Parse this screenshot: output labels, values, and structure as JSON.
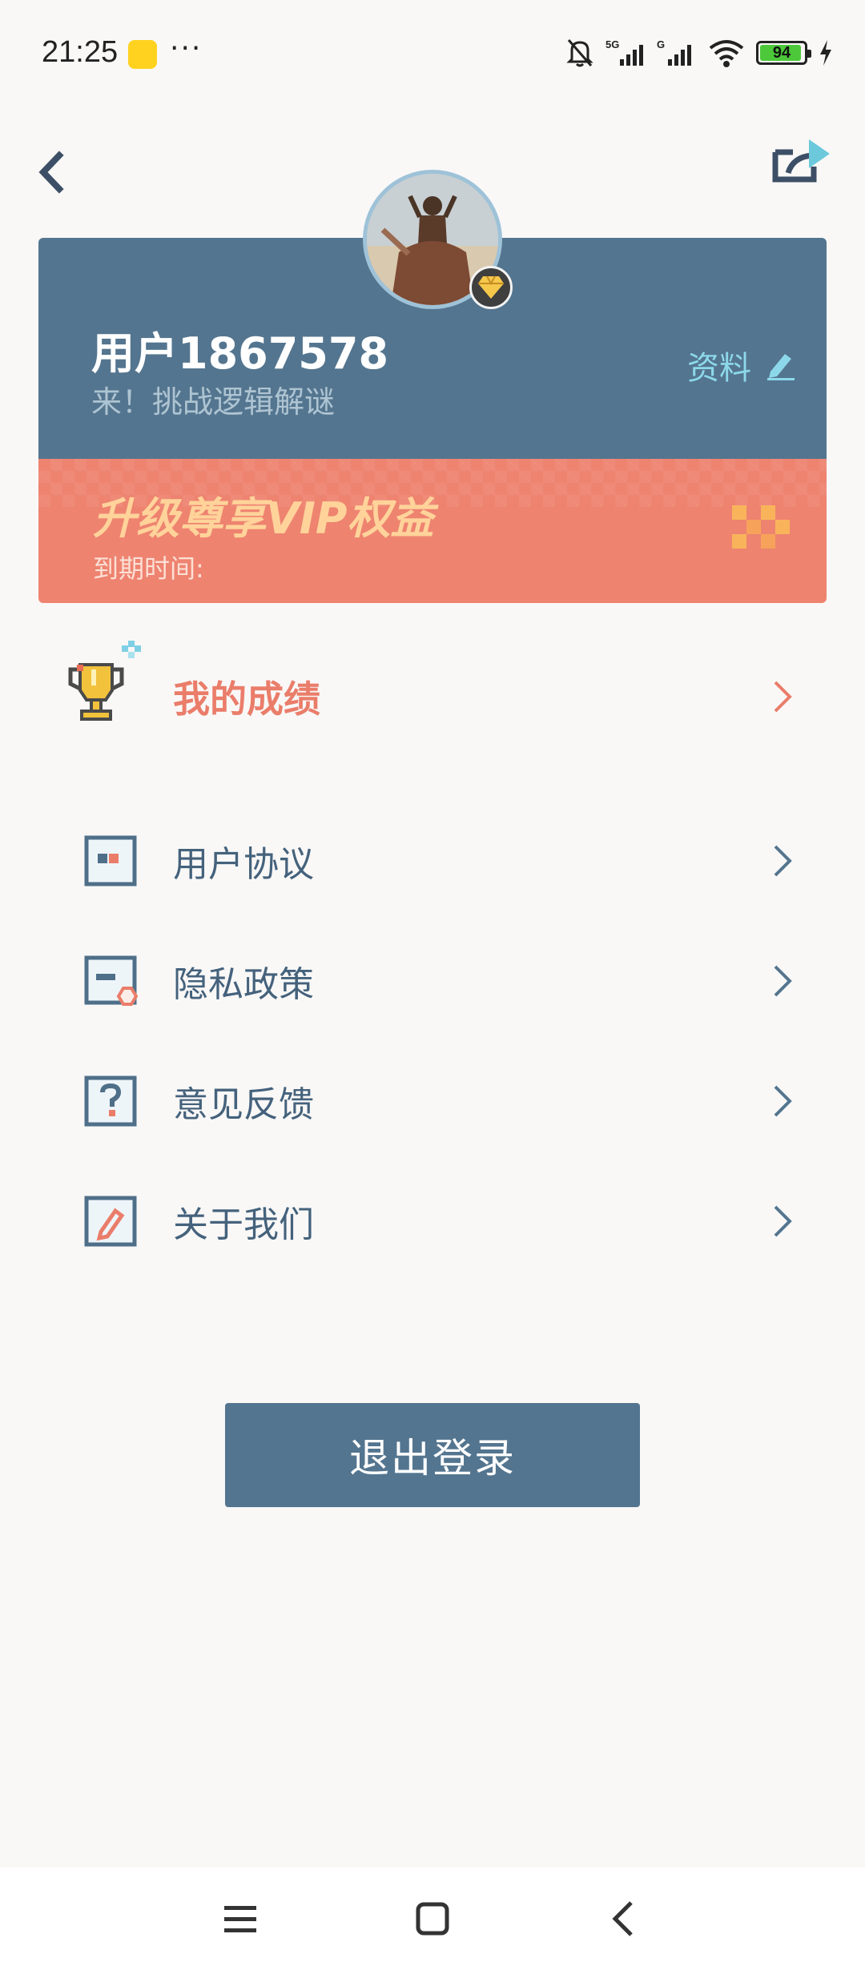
{
  "status_bar": {
    "time": "21:25",
    "overflow_dots": "···",
    "battery_level": "94",
    "network": "5G"
  },
  "header": {
    "back_icon": "chevron-left-icon",
    "share_icon": "share-icon"
  },
  "profile": {
    "username": "用户1867578",
    "tagline": "来！挑战逻辑解谜",
    "profile_link_label": "资料",
    "profile_link_icon": "pencil-icon",
    "avatar_badge_icon": "diamond-icon"
  },
  "vip": {
    "title": "升级尊享VIP权益",
    "expire_label": "到期时间:"
  },
  "achievements": {
    "label": "我的成绩",
    "icon": "trophy-icon"
  },
  "menu": {
    "items": [
      {
        "label": "用户协议",
        "icon": "agreement-icon"
      },
      {
        "label": "隐私政策",
        "icon": "privacy-icon"
      },
      {
        "label": "意见反馈",
        "icon": "feedback-icon"
      },
      {
        "label": "关于我们",
        "icon": "about-icon"
      }
    ]
  },
  "logout_label": "退出登录",
  "colors": {
    "primary": "#54758f",
    "vip": "#ee8370",
    "accent": "#ea7d6a",
    "link": "#8cd8ea",
    "background": "#f9f8f7"
  }
}
